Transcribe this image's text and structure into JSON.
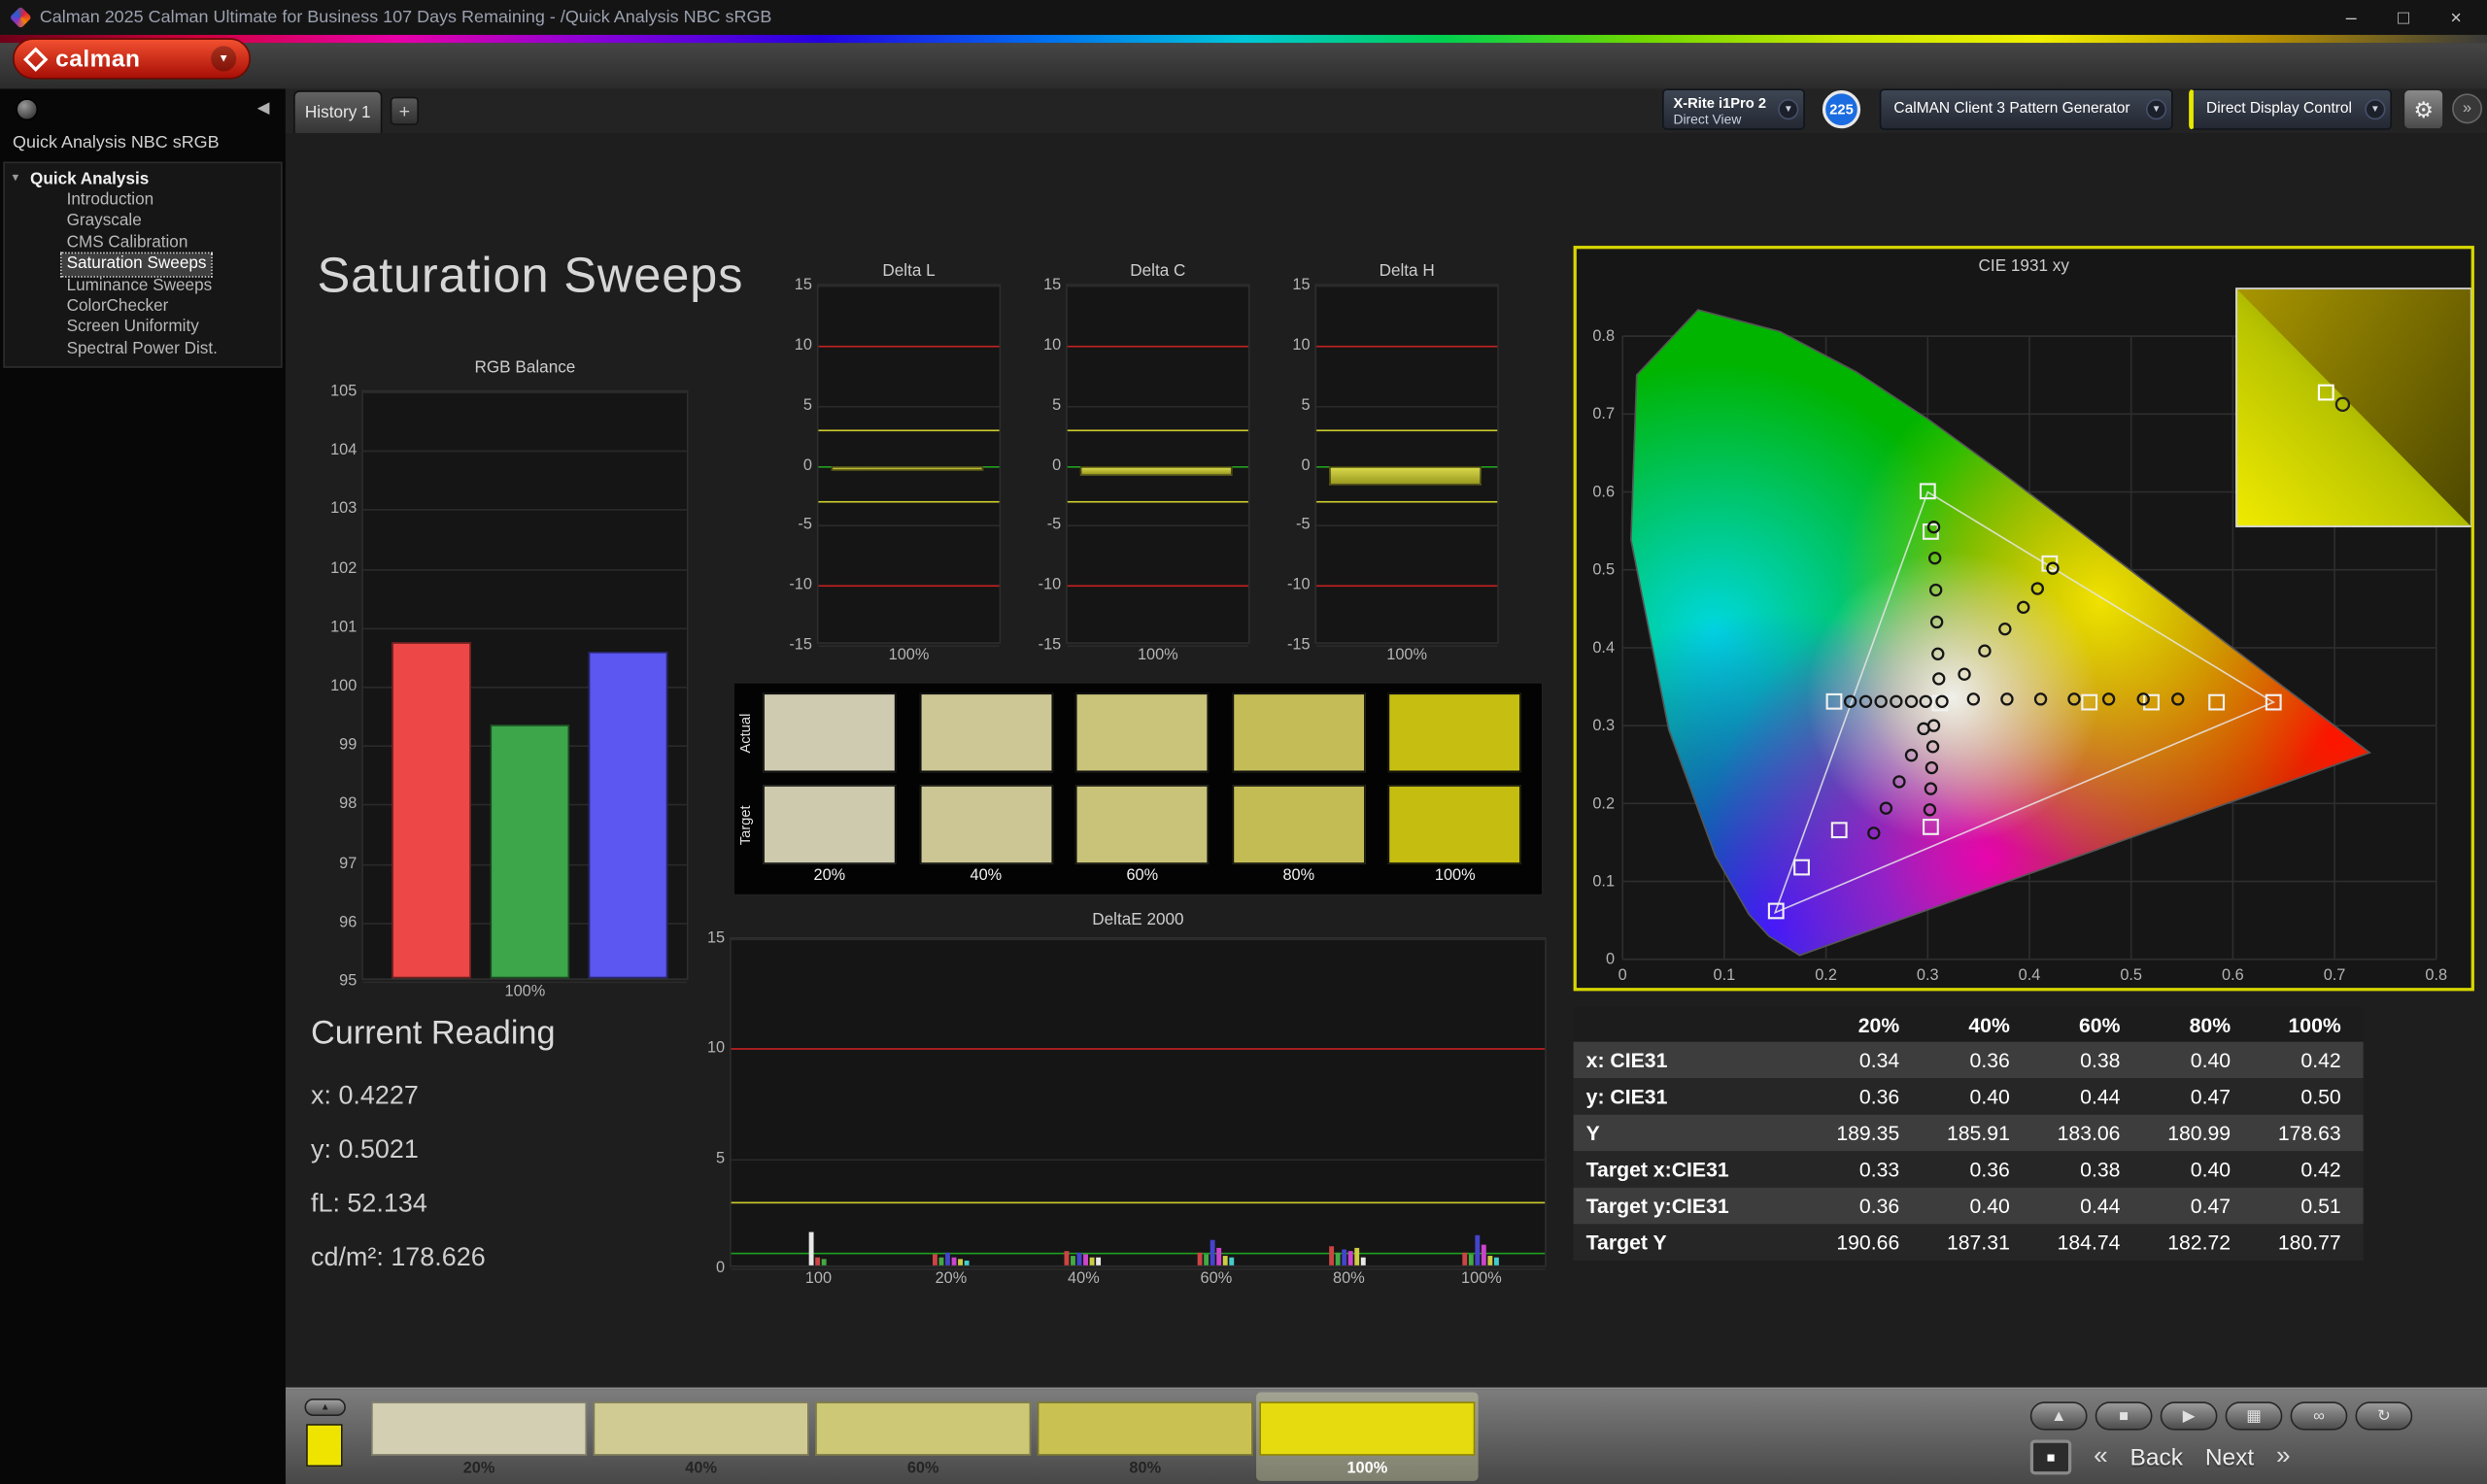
{
  "window": {
    "title": "Calman 2025 Calman Ultimate for Business 107 Days Remaining  - /Quick Analysis NBC sRGB",
    "minimize": "–",
    "maximize": "□",
    "close": "×"
  },
  "header": {
    "logo_text": "calman",
    "tab_label": "History 1",
    "new_tab_label": "+",
    "meter_line1": "X-Rite i1Pro 2",
    "meter_line2": "Direct View",
    "badge_count": "225",
    "pattern_generator_label": "CalMAN Client 3 Pattern Generator",
    "display_control_label": "Direct Display Control",
    "dropdown_arrow": "▼",
    "gear_glyph": "⚙",
    "chevron_glyph": "»",
    "accent_yellow": "#e8e800"
  },
  "sidebar": {
    "workflow_title": "Quick Analysis NBC sRGB",
    "root_label": "Quick Analysis",
    "collapse_glyph": "◀",
    "items": [
      "Introduction",
      "Grayscale",
      "CMS Calibration",
      "Saturation Sweeps",
      "Luminance Sweeps",
      "ColorChecker",
      "Screen Uniformity",
      "Spectral Power Dist."
    ],
    "selected_item": "Saturation Sweeps"
  },
  "main": {
    "page_title": "Saturation Sweeps",
    "current_reading": {
      "heading": "Current Reading",
      "line_x": "x: 0.4227",
      "line_y": "y: 0.5021",
      "line_fl": "fL: 52.134",
      "line_cd": "cd/m²: 178.626"
    }
  },
  "chart_data": {
    "rgb_balance": {
      "type": "bar",
      "title": "RGB Balance",
      "ylim": [
        95,
        105
      ],
      "ytick_step": 1,
      "xlabel": "100%",
      "bars": [
        {
          "name": "red",
          "color": "#ee4747",
          "value": 100.7
        },
        {
          "name": "green",
          "color": "#3da64b",
          "value": 99.3
        },
        {
          "name": "blue",
          "color": "#5b57f0",
          "value": 100.55
        }
      ]
    },
    "delta_charts": {
      "type": "bar",
      "ylim": [
        -15,
        15
      ],
      "ytick_step": 5,
      "ref_red": [
        10,
        -10
      ],
      "ref_yellow": [
        3,
        -3
      ],
      "ref_green": 0,
      "charts": [
        {
          "title": "Delta L",
          "value": -0.5,
          "xlabel": "100%"
        },
        {
          "title": "Delta C",
          "value": -0.9,
          "xlabel": "100%"
        },
        {
          "title": "Delta H",
          "value": -1.6,
          "xlabel": "100%"
        }
      ]
    },
    "saturation_swatches": {
      "row_labels": [
        "Actual",
        "Target"
      ],
      "levels": [
        "20%",
        "40%",
        "60%",
        "80%",
        "100%"
      ],
      "actual": [
        "#cecbb1",
        "#ccc795",
        "#c9c47a",
        "#c4bd57",
        "#c6bf12"
      ],
      "target": [
        "#cdcaae",
        "#cbc693",
        "#c8c378",
        "#c3bc55",
        "#c5be10"
      ]
    },
    "deltae2000": {
      "type": "bar",
      "title": "DeltaE 2000",
      "ylim": [
        0,
        15
      ],
      "yticks": [
        0,
        5,
        10,
        15
      ],
      "ref_red": 10,
      "ref_yellow": 3,
      "ref_green": 0.7,
      "groups": [
        {
          "label": "100",
          "bars": [
            [
              "#e8e8e8",
              1.5
            ],
            [
              "#cc4444",
              0.35
            ],
            [
              "#44aa44",
              0.3
            ]
          ]
        },
        {
          "label": "20%",
          "bars": [
            [
              "#cc4444",
              0.5
            ],
            [
              "#44aa44",
              0.35
            ],
            [
              "#4444cc",
              0.55
            ],
            [
              "#cc44cc",
              0.4
            ],
            [
              "#cccc44",
              0.3
            ],
            [
              "#44cccc",
              0.25
            ]
          ]
        },
        {
          "label": "40%",
          "bars": [
            [
              "#cc4444",
              0.65
            ],
            [
              "#44aa44",
              0.45
            ],
            [
              "#4444cc",
              0.6
            ],
            [
              "#cc44cc",
              0.5
            ],
            [
              "#cccc44",
              0.35
            ],
            [
              "#e8e8e8",
              0.4
            ]
          ]
        },
        {
          "label": "60%",
          "bars": [
            [
              "#cc4444",
              0.6
            ],
            [
              "#44aa44",
              0.5
            ],
            [
              "#4444cc",
              1.15
            ],
            [
              "#cc44cc",
              0.8
            ],
            [
              "#cccc44",
              0.45
            ],
            [
              "#44cccc",
              0.35
            ]
          ]
        },
        {
          "label": "80%",
          "bars": [
            [
              "#cc4444",
              0.9
            ],
            [
              "#44aa44",
              0.55
            ],
            [
              "#4444cc",
              0.75
            ],
            [
              "#cc44cc",
              0.65
            ],
            [
              "#cccc44",
              0.8
            ],
            [
              "#e8e8e8",
              0.35
            ]
          ]
        },
        {
          "label": "100%",
          "bars": [
            [
              "#cc4444",
              0.6
            ],
            [
              "#44aa44",
              0.5
            ],
            [
              "#4444cc",
              1.4
            ],
            [
              "#cc44cc",
              0.95
            ],
            [
              "#cccc44",
              0.45
            ],
            [
              "#44cccc",
              0.4
            ]
          ]
        }
      ]
    },
    "cie1931": {
      "type": "scatter",
      "title": "CIE 1931 xy",
      "xlim": [
        0,
        0.8
      ],
      "ylim": [
        0,
        0.8
      ],
      "tick_step": 0.1,
      "triangle": [
        [
          0.64,
          0.33
        ],
        [
          0.3,
          0.6
        ],
        [
          0.15,
          0.06
        ]
      ],
      "squares": [
        [
          0.3,
          0.601
        ],
        [
          0.303,
          0.549
        ],
        [
          0.208,
          0.331
        ],
        [
          0.459,
          0.33
        ],
        [
          0.52,
          0.33
        ],
        [
          0.584,
          0.33
        ],
        [
          0.64,
          0.33
        ],
        [
          0.303,
          0.17
        ],
        [
          0.213,
          0.166
        ],
        [
          0.176,
          0.118
        ],
        [
          0.151,
          0.062
        ],
        [
          0.42,
          0.508
        ],
        [
          0.312,
          0.329
        ]
      ],
      "circles": [
        [
          0.306,
          0.555
        ],
        [
          0.307,
          0.515
        ],
        [
          0.308,
          0.474
        ],
        [
          0.309,
          0.433
        ],
        [
          0.31,
          0.392
        ],
        [
          0.311,
          0.36
        ],
        [
          0.336,
          0.366
        ],
        [
          0.356,
          0.396
        ],
        [
          0.376,
          0.424
        ],
        [
          0.394,
          0.452
        ],
        [
          0.408,
          0.476
        ],
        [
          0.423,
          0.502
        ],
        [
          0.345,
          0.334
        ],
        [
          0.378,
          0.334
        ],
        [
          0.411,
          0.334
        ],
        [
          0.444,
          0.334
        ],
        [
          0.478,
          0.334
        ],
        [
          0.512,
          0.334
        ],
        [
          0.546,
          0.334
        ],
        [
          0.224,
          0.331
        ],
        [
          0.239,
          0.331
        ],
        [
          0.254,
          0.331
        ],
        [
          0.269,
          0.331
        ],
        [
          0.284,
          0.331
        ],
        [
          0.298,
          0.331
        ],
        [
          0.306,
          0.3
        ],
        [
          0.305,
          0.273
        ],
        [
          0.304,
          0.246
        ],
        [
          0.303,
          0.219
        ],
        [
          0.302,
          0.192
        ],
        [
          0.296,
          0.296
        ],
        [
          0.284,
          0.262
        ],
        [
          0.272,
          0.228
        ],
        [
          0.259,
          0.194
        ],
        [
          0.247,
          0.162
        ],
        [
          0.314,
          0.331
        ]
      ]
    },
    "results_table": {
      "columns": [
        "20%",
        "40%",
        "60%",
        "80%",
        "100%"
      ],
      "rows": [
        {
          "label": "x: CIE31",
          "values": [
            "0.34",
            "0.36",
            "0.38",
            "0.40",
            "0.42"
          ]
        },
        {
          "label": "y: CIE31",
          "values": [
            "0.36",
            "0.40",
            "0.44",
            "0.47",
            "0.50"
          ]
        },
        {
          "label": "Y",
          "values": [
            "189.35",
            "185.91",
            "183.06",
            "180.99",
            "178.63"
          ]
        },
        {
          "label": "Target x:CIE31",
          "values": [
            "0.33",
            "0.36",
            "0.38",
            "0.40",
            "0.42"
          ]
        },
        {
          "label": "Target y:CIE31",
          "values": [
            "0.36",
            "0.40",
            "0.44",
            "0.47",
            "0.51"
          ]
        },
        {
          "label": "Target Y",
          "values": [
            "190.66",
            "187.31",
            "184.74",
            "182.72",
            "180.77"
          ]
        }
      ]
    }
  },
  "bottom_bar": {
    "left_swatch_color": "#efe400",
    "flyout_glyph": "▲",
    "patches": [
      {
        "label": "20%",
        "color": "#d2cfb2"
      },
      {
        "label": "40%",
        "color": "#d0cb92"
      },
      {
        "label": "60%",
        "color": "#cdc875"
      },
      {
        "label": "80%",
        "color": "#c9c252"
      },
      {
        "label": "100%",
        "color": "#e6db0e",
        "selected": true
      }
    ],
    "transport": [
      {
        "name": "eject-button",
        "glyph": "▲"
      },
      {
        "name": "stop-button",
        "glyph": "■"
      },
      {
        "name": "play-button",
        "glyph": "▶"
      },
      {
        "name": "save-button",
        "glyph": "▦"
      },
      {
        "name": "loop-button",
        "glyph": "∞"
      },
      {
        "name": "refresh-button",
        "glyph": "↻"
      }
    ],
    "stop_square_glyph": "■",
    "prev_glyph": "«",
    "back_label": "Back",
    "next_label": "Next",
    "next_glyph": "»"
  }
}
